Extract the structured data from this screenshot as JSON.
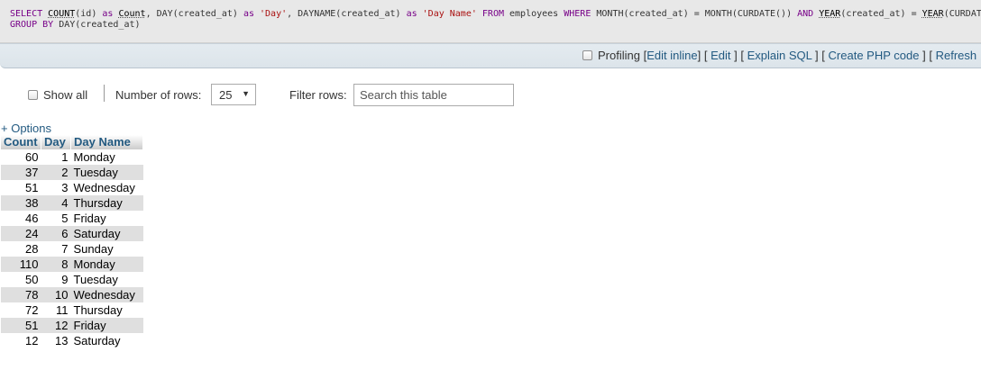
{
  "sql": {
    "line1": [
      {
        "t": "SELECT",
        "c": "kw"
      },
      {
        "t": " ",
        "c": "plain"
      },
      {
        "t": "COUNT",
        "c": "fn"
      },
      {
        "t": "(id) ",
        "c": "plain"
      },
      {
        "t": "as",
        "c": "kw"
      },
      {
        "t": " ",
        "c": "plain"
      },
      {
        "t": "Count",
        "c": "fn"
      },
      {
        "t": ", DAY(created_at) ",
        "c": "plain"
      },
      {
        "t": "as",
        "c": "kw"
      },
      {
        "t": " ",
        "c": "plain"
      },
      {
        "t": "'Day'",
        "c": "str"
      },
      {
        "t": ", DAYNAME(created_at) ",
        "c": "plain"
      },
      {
        "t": "as",
        "c": "kw"
      },
      {
        "t": " ",
        "c": "plain"
      },
      {
        "t": "'Day Name'",
        "c": "str"
      },
      {
        "t": " ",
        "c": "plain"
      },
      {
        "t": "FROM",
        "c": "kw"
      },
      {
        "t": " employees ",
        "c": "plain"
      },
      {
        "t": "WHERE",
        "c": "kw"
      },
      {
        "t": " MONTH(created_at) = MONTH(CURDATE()) ",
        "c": "plain"
      },
      {
        "t": "AND",
        "c": "kw"
      },
      {
        "t": " ",
        "c": "plain"
      },
      {
        "t": "YEAR",
        "c": "fn"
      },
      {
        "t": "(created_at) = ",
        "c": "plain"
      },
      {
        "t": "YEAR",
        "c": "fn"
      },
      {
        "t": "(CURDATE())",
        "c": "plain"
      }
    ],
    "line2": [
      {
        "t": "GROUP BY",
        "c": "kw"
      },
      {
        "t": " DAY(created_at)",
        "c": "plain"
      }
    ]
  },
  "toolbar": {
    "profiling_label": "Profiling",
    "edit_inline": "Edit inline",
    "edit": "Edit",
    "explain_sql": "Explain SQL",
    "create_php": "Create PHP code",
    "refresh": "Refresh"
  },
  "nav": {
    "show_all_label": "Show all",
    "rows_label": "Number of rows:",
    "rows_value": "25",
    "filter_label": "Filter rows:",
    "filter_placeholder": "Search this table"
  },
  "options_label": "+ Options",
  "table": {
    "headers": [
      "Count",
      "Day",
      "Day Name"
    ],
    "rows": [
      [
        "60",
        "1",
        "Monday"
      ],
      [
        "37",
        "2",
        "Tuesday"
      ],
      [
        "51",
        "3",
        "Wednesday"
      ],
      [
        "38",
        "4",
        "Thursday"
      ],
      [
        "46",
        "5",
        "Friday"
      ],
      [
        "24",
        "6",
        "Saturday"
      ],
      [
        "28",
        "7",
        "Sunday"
      ],
      [
        "110",
        "8",
        "Monday"
      ],
      [
        "50",
        "9",
        "Tuesday"
      ],
      [
        "78",
        "10",
        "Wednesday"
      ],
      [
        "72",
        "11",
        "Thursday"
      ],
      [
        "51",
        "12",
        "Friday"
      ],
      [
        "12",
        "13",
        "Saturday"
      ]
    ]
  },
  "colors": {
    "link": "#235a81",
    "sql_keyword": "#770088",
    "sql_string": "#aa1111",
    "row_stripe": "#dfdfdf"
  }
}
